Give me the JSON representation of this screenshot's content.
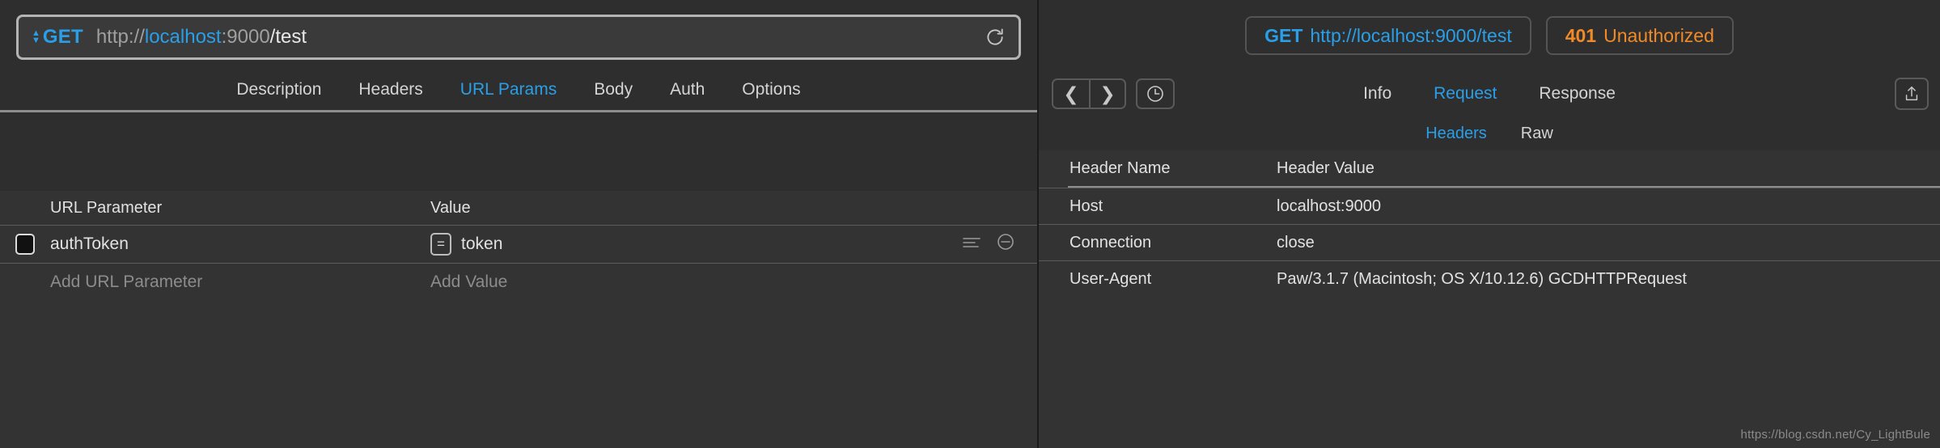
{
  "request": {
    "method": "GET",
    "method_stepper_icon": "up-down-stepper-icon",
    "url": {
      "scheme": "http://",
      "host": "localhost",
      "colon": ":",
      "port": "9000",
      "path": "/test",
      "full": "http://localhost:9000/test"
    },
    "refresh_icon": "refresh-icon",
    "tabs": [
      {
        "label": "Description",
        "active": false
      },
      {
        "label": "Headers",
        "active": false
      },
      {
        "label": "URL Params",
        "active": true
      },
      {
        "label": "Body",
        "active": false
      },
      {
        "label": "Auth",
        "active": false
      },
      {
        "label": "Options",
        "active": false
      }
    ],
    "params_table": {
      "columns": [
        "URL Parameter",
        "Value"
      ],
      "rows": [
        {
          "checked": false,
          "name": "authToken",
          "operator": "=",
          "value": "token",
          "list_icon": "list-lines-icon",
          "remove_icon": "remove-circle-icon"
        }
      ],
      "add_row": {
        "name_placeholder": "Add URL Parameter",
        "value_placeholder": "Add Value"
      }
    }
  },
  "response": {
    "request_pill": {
      "method": "GET",
      "url": "http://localhost:9000/test"
    },
    "status_pill": {
      "code": "401",
      "text": "Unauthorized"
    },
    "nav": {
      "back_icon": "chevron-left-icon",
      "forward_icon": "chevron-right-icon",
      "history_icon": "clock-icon",
      "share_icon": "share-upload-icon"
    },
    "tabs": [
      {
        "label": "Info",
        "active": false
      },
      {
        "label": "Request",
        "active": true
      },
      {
        "label": "Response",
        "active": false
      }
    ],
    "subtabs": [
      {
        "label": "Headers",
        "active": true
      },
      {
        "label": "Raw",
        "active": false
      }
    ],
    "headers_table": {
      "columns": [
        "Header Name",
        "Header Value"
      ],
      "rows": [
        {
          "name": "Host",
          "value": "localhost:9000"
        },
        {
          "name": "Connection",
          "value": "close"
        },
        {
          "name": "User-Agent",
          "value": "Paw/3.1.7 (Macintosh; OS X/10.12.6) GCDHTTPRequest"
        }
      ]
    }
  },
  "watermark": "https://blog.csdn.net/Cy_LightBule",
  "colors": {
    "accent_blue": "#2a9fe8",
    "status_orange": "#f08a28",
    "panel_bg": "#2e2e2e",
    "table_bg": "#333333",
    "text": "#e2e2e2",
    "muted": "#8c8c8c"
  }
}
